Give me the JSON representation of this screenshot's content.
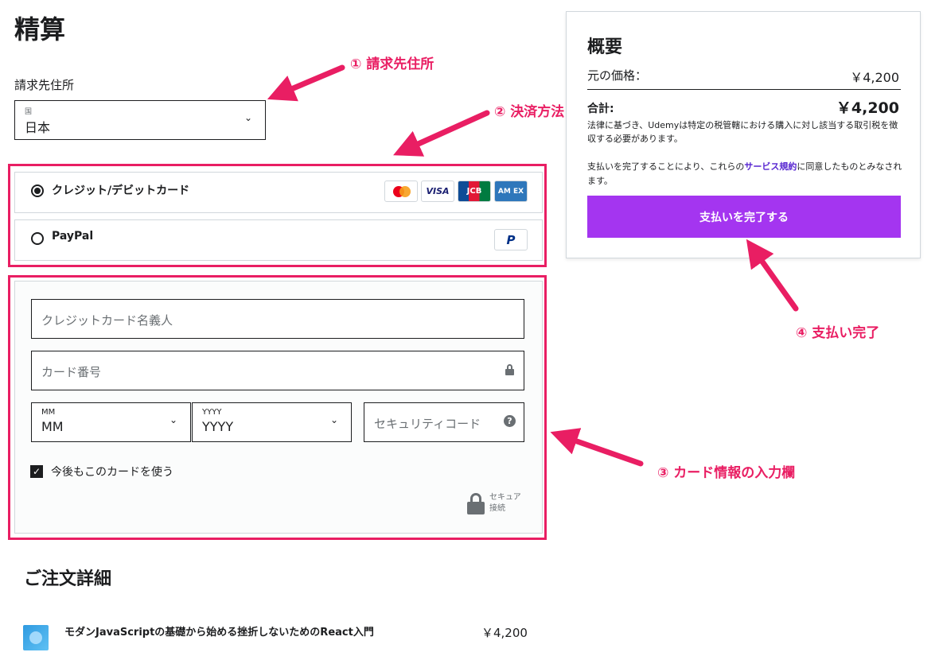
{
  "page": {
    "title": "精算"
  },
  "billing": {
    "label": "請求先住所",
    "country_caption": "国",
    "country_value": "日本"
  },
  "payment_methods": [
    {
      "label": "クレジット/デビットカード",
      "selected": true,
      "logos": [
        "mastercard-icon",
        "visa-icon",
        "jcb-icon",
        "amex-icon"
      ]
    },
    {
      "label": "PayPal",
      "selected": false,
      "logos": [
        "paypal-icon"
      ]
    }
  ],
  "card_logos": {
    "visa": "VISA",
    "jcb": "JCB",
    "amex": "AM EX",
    "paypal": "P"
  },
  "card_form": {
    "name_placeholder": "クレジットカード名義人",
    "number_placeholder": "カード番号",
    "month_caption": "MM",
    "month_value": "MM",
    "year_caption": "YYYY",
    "year_value": "YYYY",
    "cvc_placeholder": "セキュリティコード",
    "cvc_help": "?",
    "save_card_label": "今後もこのカードを使う",
    "save_card_checked": true,
    "secure_label_1": "セキュア",
    "secure_label_2": "接続"
  },
  "order": {
    "title": "ご注文詳細",
    "items": [
      {
        "title": "モダンJavaScriptの基礎から始める挫折しないためのReact入門",
        "price": "￥4,200"
      }
    ]
  },
  "summary": {
    "title": "概要",
    "original_price_label": "元の価格：",
    "original_price": "￥4,200",
    "total_label": "合計:",
    "total_price": "￥4,200",
    "tax_note": "法律に基づき、Udemyは特定の税管轄における購入に対し該当する取引税を徴収する必要があります。",
    "agree_prefix": "支払いを完了することにより、これらの",
    "agree_link": "サービス規約",
    "agree_suffix": "に同意したものとみなされます。",
    "complete_button": "支払いを完了する"
  },
  "annotations": {
    "billing": "① 請求先住所",
    "payment_method": "② 決済方法",
    "card_info": "③ カード情報の入力欄",
    "complete": "④ 支払い完了"
  },
  "colors": {
    "highlight": "#e91e63",
    "primary_button": "#a435f0",
    "link": "#5624d0"
  }
}
